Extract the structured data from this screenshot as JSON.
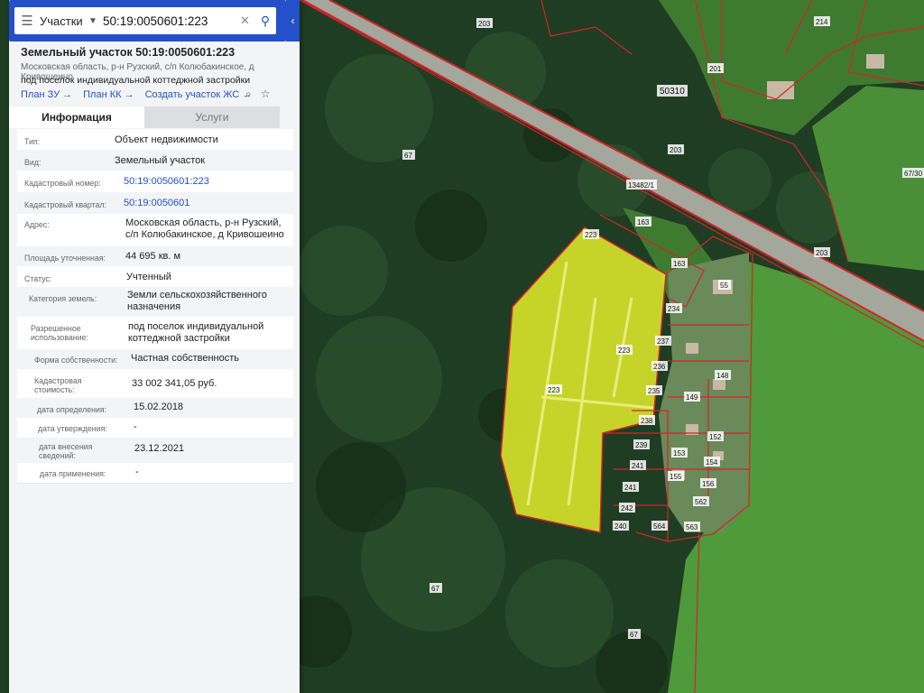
{
  "search": {
    "category": "Участки",
    "query": "50:19:0050601:223"
  },
  "card": {
    "title": "Земельный участок 50:19:0050601:223",
    "address": "Московская область, р-н Рузский, с/п Колюбакинское, д Кривошеино",
    "purpose": "под поселок индивидуальной коттеджной застройки",
    "links": [
      "План ЗУ →",
      "План КК →",
      "Создать участок ЖС →"
    ]
  },
  "tabs": [
    "Информация",
    "Услуги"
  ],
  "fields": [
    {
      "label": "Тип:",
      "value": "Объект недвижимости"
    },
    {
      "label": "Вид:",
      "value": "Земельный участок"
    },
    {
      "label": "Кадастровый номер:",
      "value": "50:19:0050601:223"
    },
    {
      "label": "Кадастровый квартал:",
      "value": "50:19:0050601"
    },
    {
      "label": "Адрес:",
      "value": "Московская область, р-н Рузский, с/п Колюбакинское, д Кривошеино"
    },
    {
      "label": "Площадь уточненная:",
      "value": "44 695 кв. м"
    },
    {
      "label": "Статус:",
      "value": "Учтенный"
    },
    {
      "label": "Категория земель:",
      "value": "Земли сельскохозяйственного назначения"
    },
    {
      "label": "Разрешенное использование:",
      "value": "под поселок индивидуальной коттеджной застройки"
    },
    {
      "label": "Форма собственности:",
      "value": "Частная собственность"
    },
    {
      "label": "Кадастровая стоимость:",
      "value": "33 002 341,05 руб."
    },
    {
      "label": "дата определения:",
      "value": "15.02.2018"
    },
    {
      "label": "дата утверждения:",
      "value": "-"
    },
    {
      "label": "дата внесения сведений:",
      "value": "23.12.2021"
    },
    {
      "label": "дата применения:",
      "value": "-"
    }
  ],
  "map_labels": {
    "parcel": "223",
    "road": "13482/1",
    "quarter": "50310",
    "lot_163": "163",
    "lot_234": "234",
    "lot_203": "203",
    "lot_67": "67",
    "lot_55": "55",
    "lot_238": "238",
    "lot_239": "239",
    "lot_240": "240",
    "lot_241": "241",
    "lot_242": "242",
    "lot_237": "237",
    "lot_236": "236",
    "lot_235": "235",
    "lot_155": "155",
    "lot_156": "156",
    "lot_153": "153",
    "lot_154": "154",
    "lot_152": "152",
    "lot_564": "564",
    "lot_562": "562",
    "lot_563": "563",
    "lot_148": "148",
    "lot_149": "149",
    "lot_214": "214",
    "lot_201": "201",
    "lot_67_30": "67/30"
  },
  "colors": {
    "accent": "#2451c9",
    "parcel_fill": "#e4ee2c",
    "boundary": "#d4242a",
    "forest": "#1f3d22",
    "field": "#4f9a3a"
  }
}
